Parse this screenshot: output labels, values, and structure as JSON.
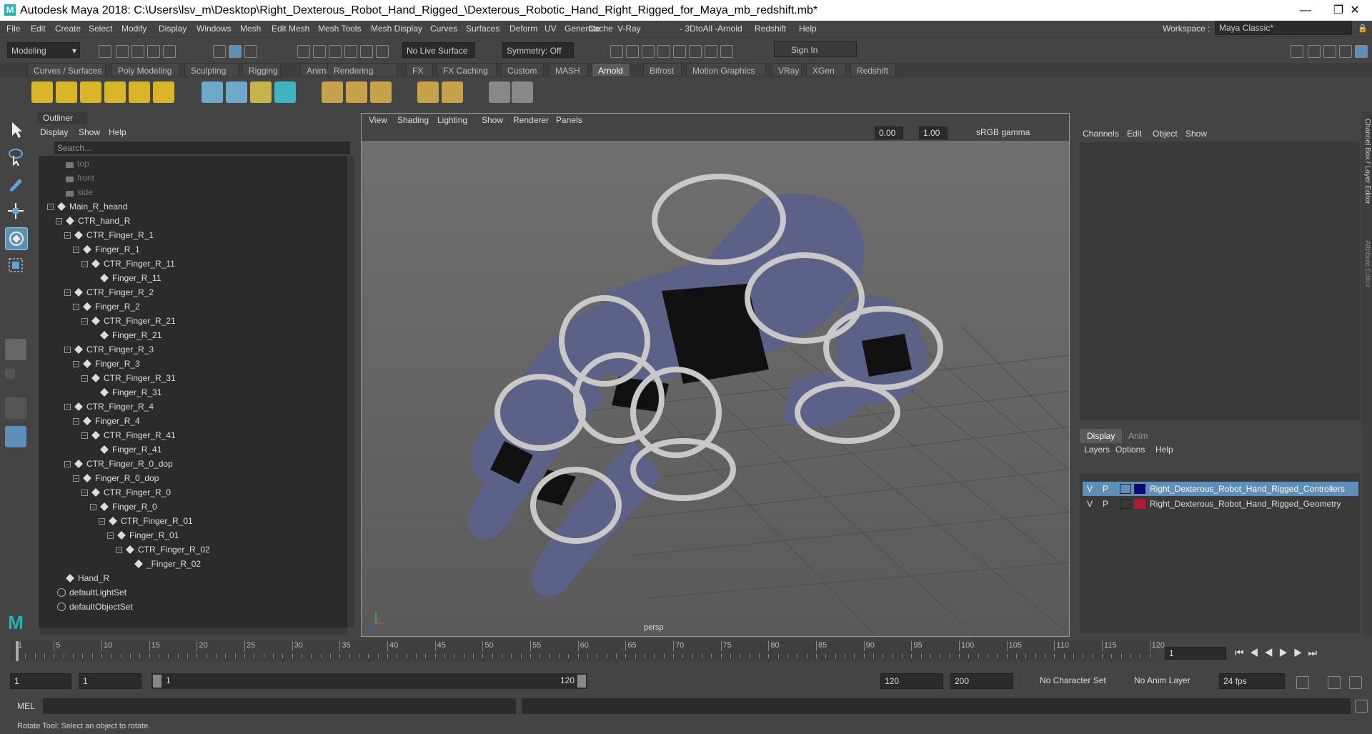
{
  "window": {
    "title": "Autodesk Maya 2018: C:\\Users\\lsv_m\\Desktop\\Right_Dexterous_Robot_Hand_Rigged_\\Dexterous_Robotic_Hand_Right_Rigged_for_Maya_mb_redshift.mb*",
    "logo": "M"
  },
  "menu": [
    "File",
    "Edit",
    "Create",
    "Select",
    "Modify",
    "Display",
    "Windows",
    "Mesh",
    "Edit Mesh",
    "Mesh Tools",
    "Mesh Display",
    "Curves",
    "Surfaces",
    "Deform",
    "UV",
    "Generate",
    "Cache",
    "V-Ray",
    "- 3DtoAll -",
    "Arnold",
    "Redshift",
    "Help"
  ],
  "workspace": {
    "label": "Workspace :",
    "value": "Maya Classic*"
  },
  "status": {
    "mode": "Modeling",
    "live_surface": "No Live Surface",
    "symmetry": "Symmetry: Off",
    "sign_in": "Sign In"
  },
  "shelf_tabs": [
    "Curves / Surfaces",
    "Poly Modeling",
    "Sculpting",
    "Rigging",
    "Animation",
    "Rendering",
    "FX",
    "FX Caching",
    "Custom",
    "MASH",
    "Arnold",
    "Bifrost",
    "Motion Graphics",
    "VRay",
    "XGen",
    "Redshift"
  ],
  "active_shelf": "Arnold",
  "outliner": {
    "title": "Outliner",
    "menu": [
      "Display",
      "Show",
      "Help"
    ],
    "search_placeholder": "Search...",
    "nodes": [
      {
        "label": "top",
        "type": "camera",
        "dim": true
      },
      {
        "label": "front",
        "type": "camera",
        "dim": true
      },
      {
        "label": "side",
        "type": "camera",
        "dim": true
      },
      {
        "label": "Main_R_heand",
        "type": "joint"
      },
      {
        "label": "CTR_hand_R",
        "type": "joint"
      },
      {
        "label": "CTR_Finger_R_1",
        "type": "joint"
      },
      {
        "label": "Finger_R_1",
        "type": "joint"
      },
      {
        "label": "CTR_Finger_R_11",
        "type": "joint"
      },
      {
        "label": "Finger_R_11",
        "type": "joint"
      },
      {
        "label": "CTR_Finger_R_2",
        "type": "joint"
      },
      {
        "label": "Finger_R_2",
        "type": "joint"
      },
      {
        "label": "CTR_Finger_R_21",
        "type": "joint"
      },
      {
        "label": "Finger_R_21",
        "type": "joint"
      },
      {
        "label": "CTR_Finger_R_3",
        "type": "joint"
      },
      {
        "label": "Finger_R_3",
        "type": "joint"
      },
      {
        "label": "CTR_Finger_R_31",
        "type": "joint"
      },
      {
        "label": "Finger_R_31",
        "type": "joint"
      },
      {
        "label": "CTR_Finger_R_4",
        "type": "joint"
      },
      {
        "label": "Finger_R_4",
        "type": "joint"
      },
      {
        "label": "CTR_Finger_R_41",
        "type": "joint"
      },
      {
        "label": "Finger_R_41",
        "type": "joint"
      },
      {
        "label": "CTR_Finger_R_0_dop",
        "type": "joint"
      },
      {
        "label": "Finger_R_0_dop",
        "type": "joint"
      },
      {
        "label": "CTR_Finger_R_0",
        "type": "joint"
      },
      {
        "label": "Finger_R_0",
        "type": "joint"
      },
      {
        "label": "CTR_Finger_R_01",
        "type": "joint"
      },
      {
        "label": "Finger_R_01",
        "type": "joint"
      },
      {
        "label": "CTR_Finger_R_02",
        "type": "joint"
      },
      {
        "label": "_Finger_R_02",
        "type": "joint"
      },
      {
        "label": "Hand_R",
        "type": "joint"
      },
      {
        "label": "defaultLightSet",
        "type": "set"
      },
      {
        "label": "defaultObjectSet",
        "type": "set"
      }
    ]
  },
  "viewport": {
    "menu": [
      "View",
      "Shading",
      "Lighting",
      "Show",
      "Renderer",
      "Panels"
    ],
    "exposure": "0.00",
    "gamma": "1.00",
    "color_space": "sRGB gamma",
    "camera_label": "persp"
  },
  "channel_box": {
    "menu": [
      "Channels",
      "Edit",
      "Object",
      "Show"
    ],
    "side_tab_1": "Channel Box / Layer Editor",
    "side_tab_2": "Attribute Editor"
  },
  "layers": {
    "tabs": [
      "Display",
      "Anim"
    ],
    "menu": [
      "Layers",
      "Options",
      "Help"
    ],
    "rows": [
      {
        "v": "V",
        "p": "P",
        "color": "#0a0a6e",
        "name": "Right_Dexterous_Robot_Hand_Rigged_Controllers",
        "selected": true
      },
      {
        "v": "V",
        "p": "P",
        "color": "#b01a34",
        "name": "Right_Dexterous_Robot_Hand_Rigged_Geometry",
        "selected": false
      }
    ]
  },
  "timeline": {
    "ticks": [
      "1",
      "5",
      "10",
      "15",
      "20",
      "25",
      "30",
      "35",
      "40",
      "45",
      "50",
      "55",
      "60",
      "65",
      "70",
      "75",
      "80",
      "85",
      "90",
      "95",
      "100",
      "105",
      "110",
      "115",
      "120"
    ],
    "current_frame": "1"
  },
  "range": {
    "start": "1",
    "playback_start": "1",
    "slider_start": "1",
    "slider_end": "120",
    "playback_end": "120",
    "end": "200",
    "character_set": "No Character Set",
    "anim_layer": "No Anim Layer",
    "fps": "24 fps"
  },
  "command": {
    "label": "MEL"
  },
  "help_line": "Rotate Tool: Select an object to rotate."
}
